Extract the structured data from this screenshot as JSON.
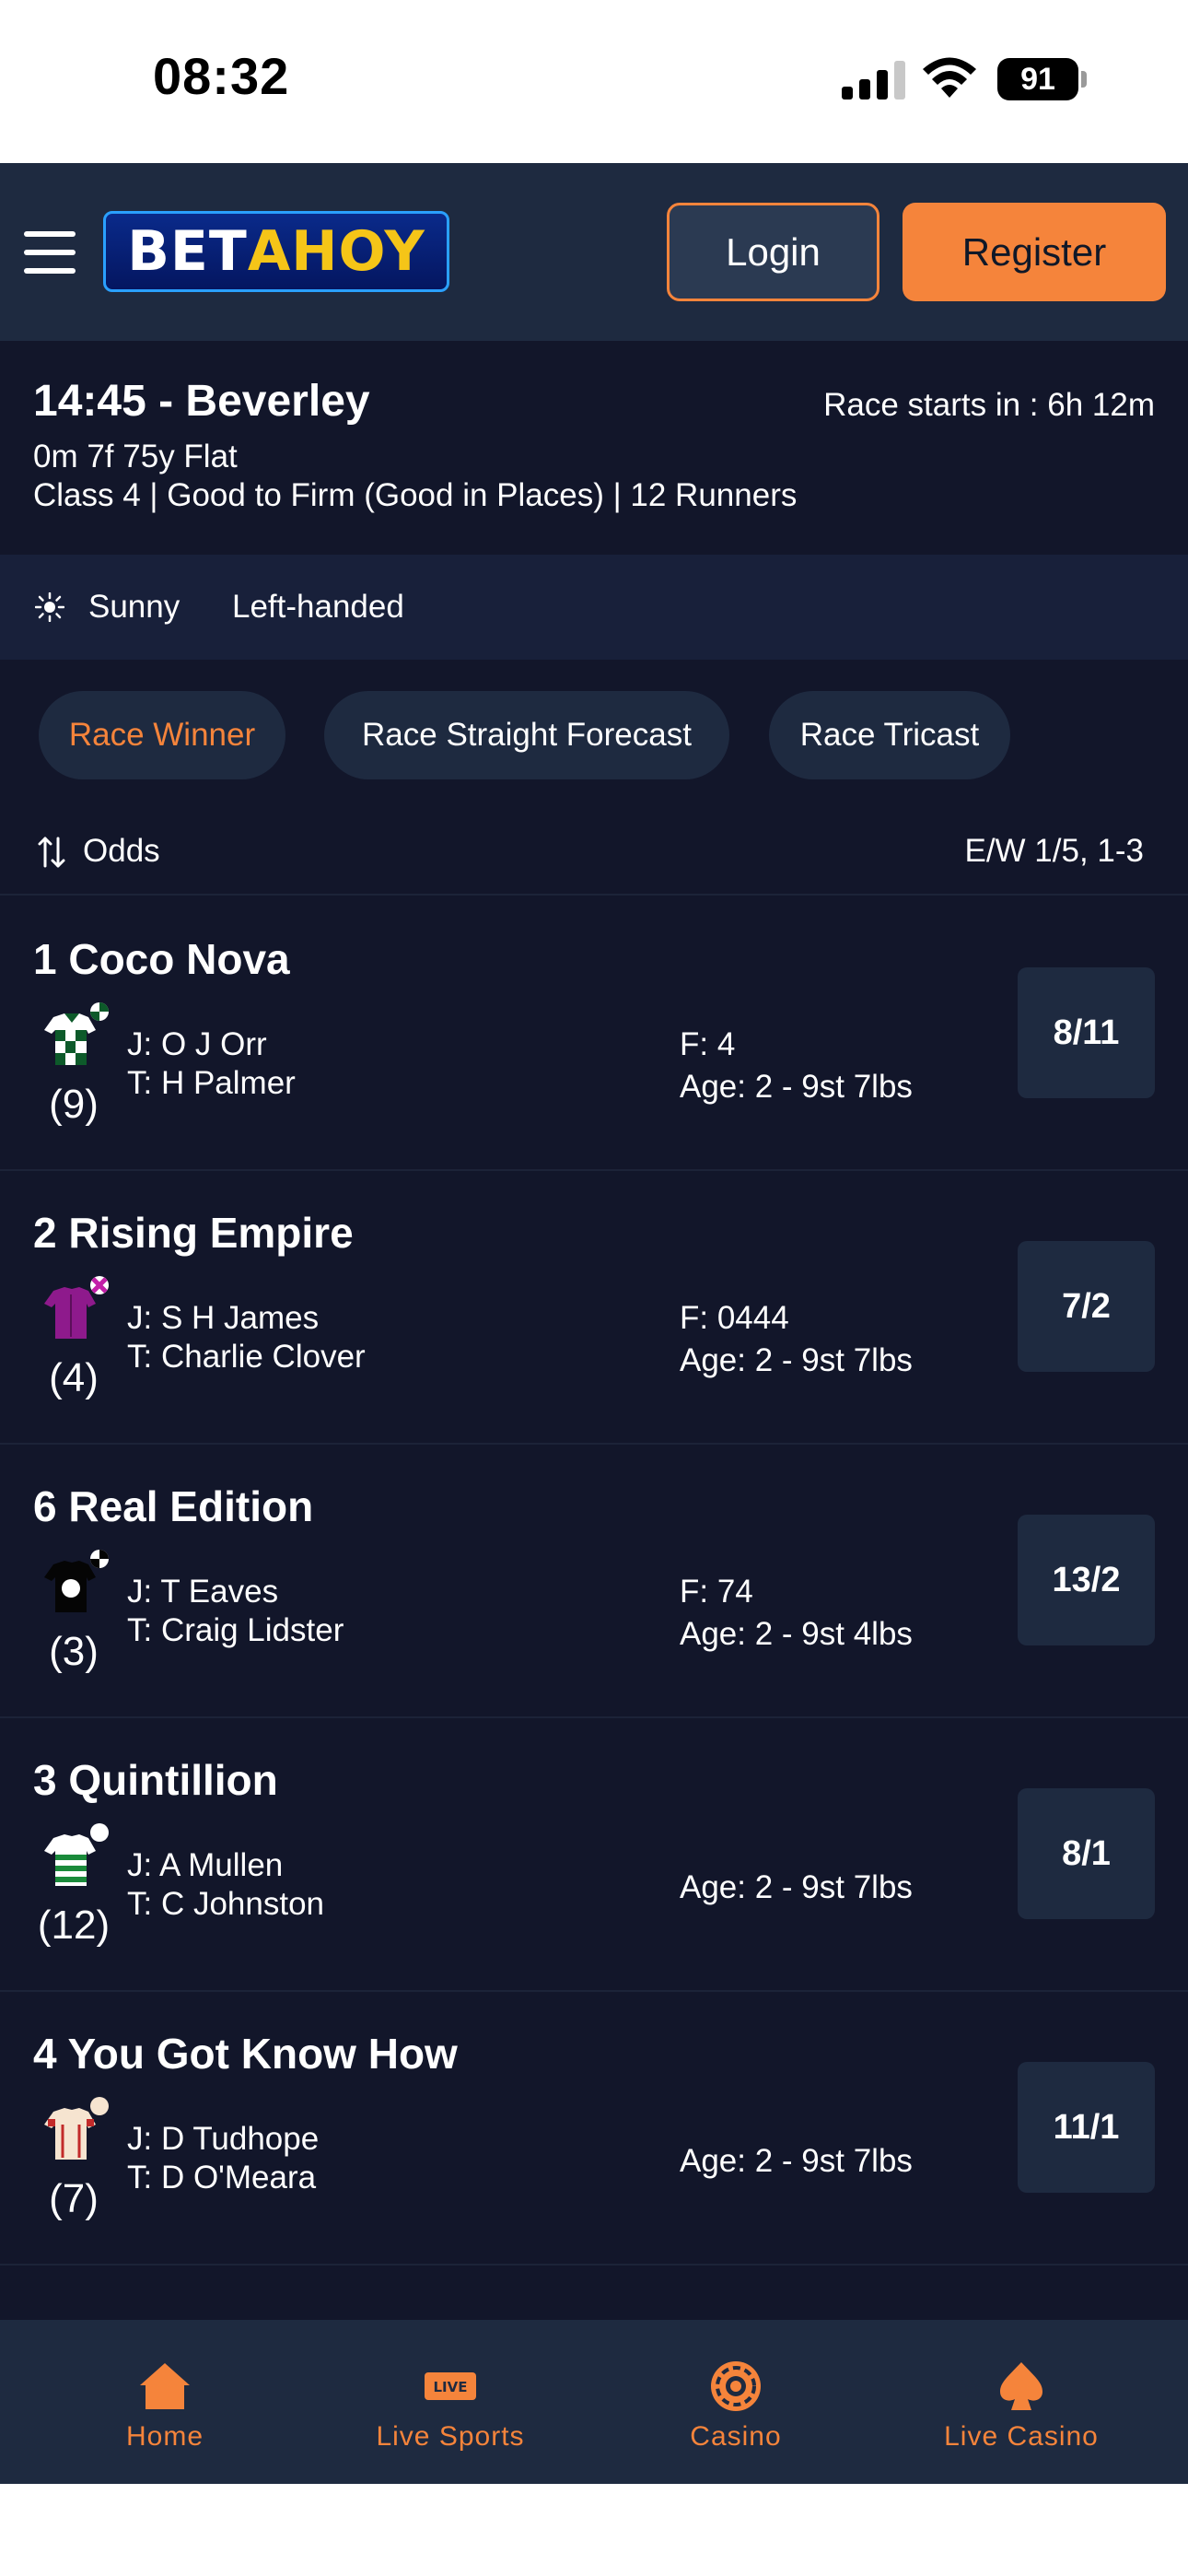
{
  "status_bar": {
    "time": "08:32",
    "battery": "91"
  },
  "header": {
    "logo_part1": "BET",
    "logo_part2": "AHOY",
    "login_label": "Login",
    "register_label": "Register"
  },
  "race": {
    "title": "14:45 - Beverley",
    "countdown": "Race starts in : 6h 12m",
    "distance": "0m 7f 75y Flat",
    "details": "Class 4 | Good to Firm (Good in Places) | 12 Runners",
    "weather": "Sunny",
    "handedness": "Left-handed"
  },
  "tabs": [
    {
      "label": "Race Winner"
    },
    {
      "label": "Race Straight Forecast"
    },
    {
      "label": "Race Tricast"
    }
  ],
  "odds_bar": {
    "sort_label": "Odds",
    "each_way": "E/W 1/5, 1-3"
  },
  "runners": [
    {
      "name": "1 Coco Nova",
      "draw": "(9)",
      "jockey": "J: O J Orr",
      "trainer": "T: H Palmer",
      "form": "F: 4",
      "age": "Age: 2 - 9st 7lbs",
      "odds": "8/11",
      "silk": "green-white-check"
    },
    {
      "name": "2 Rising Empire",
      "draw": "(4)",
      "jockey": "J: S H James",
      "trainer": "T: Charlie Clover",
      "form": "F: 0444",
      "age": "Age: 2 - 9st 7lbs",
      "odds": "7/2",
      "silk": "purple"
    },
    {
      "name": "6 Real Edition",
      "draw": "(3)",
      "jockey": "J: T Eaves",
      "trainer": "T: Craig Lidster",
      "form": "F: 74",
      "age": "Age: 2 - 9st 4lbs",
      "odds": "13/2",
      "silk": "black-white-spot"
    },
    {
      "name": "3 Quintillion",
      "draw": "(12)",
      "jockey": "J: A Mullen",
      "trainer": "T: C Johnston",
      "form": "",
      "age": "Age: 2 - 9st 7lbs",
      "odds": "8/1",
      "silk": "green-white-hoops"
    },
    {
      "name": "4 You Got Know How",
      "draw": "(7)",
      "jockey": "J: D Tudhope",
      "trainer": "T: D O'Meara",
      "form": "",
      "age": "Age: 2 - 9st 7lbs",
      "odds": "11/1",
      "silk": "cream-red"
    }
  ],
  "bottom_nav": [
    {
      "label": "Home",
      "icon": "home-icon"
    },
    {
      "label": "Live Sports",
      "icon": "live-icon"
    },
    {
      "label": "Casino",
      "icon": "casino-chip-icon"
    },
    {
      "label": "Live Casino",
      "icon": "spade-icon"
    }
  ],
  "colors": {
    "accent": "#f5843b",
    "background": "#12162a",
    "header": "#1e2a40"
  }
}
